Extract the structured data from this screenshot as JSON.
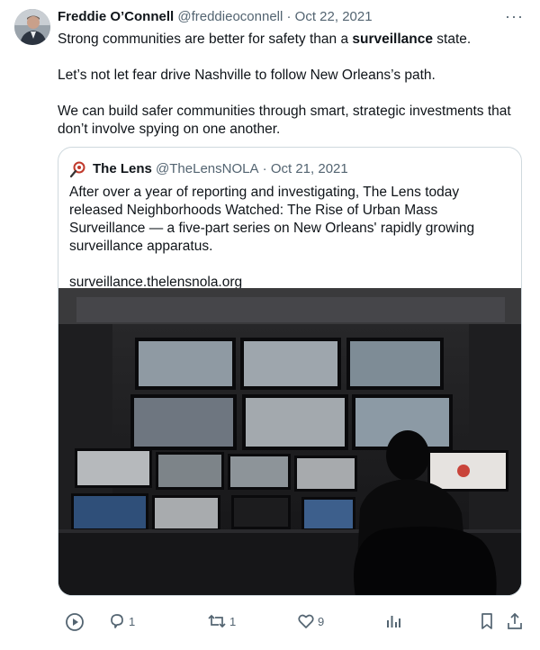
{
  "tweet": {
    "author_name": "Freddie O’Connell",
    "author_handle": "@freddieoconnell",
    "separator": "·",
    "date": "Oct 22, 2021",
    "more_label": "···",
    "text_line1_pre": "Strong communities are better for safety than a ",
    "text_line1_bold": "surveillance",
    "text_line1_post": " state.",
    "text_para2": "Let’s not let fear drive Nashville to follow New Orleans’s path.",
    "text_para3": "We can build safer communities through smart, strategic investments that don’t involve spying on one another."
  },
  "quote": {
    "author_name": "The Lens",
    "author_handle": "@TheLensNOLA",
    "separator": "·",
    "date": "Oct 21, 2021",
    "text": "After over a year of reporting and investigating, The Lens today released Neighborhoods Watched: The Rise of Urban Mass Surveillance — a five-part series on New Orleans' rapidly growing surveillance apparatus.",
    "link": "surveillance.thelensnola.org"
  },
  "actions": {
    "replies": "1",
    "retweets": "1",
    "likes": "9"
  },
  "colors": {
    "text_primary": "#0f1419",
    "text_secondary": "#536471",
    "border": "#cfd9de"
  },
  "icons": [
    "more-icon",
    "lens-logo-icon",
    "play-icon",
    "reply-icon",
    "retweet-icon",
    "like-icon",
    "views-icon",
    "bookmark-icon",
    "share-icon"
  ]
}
